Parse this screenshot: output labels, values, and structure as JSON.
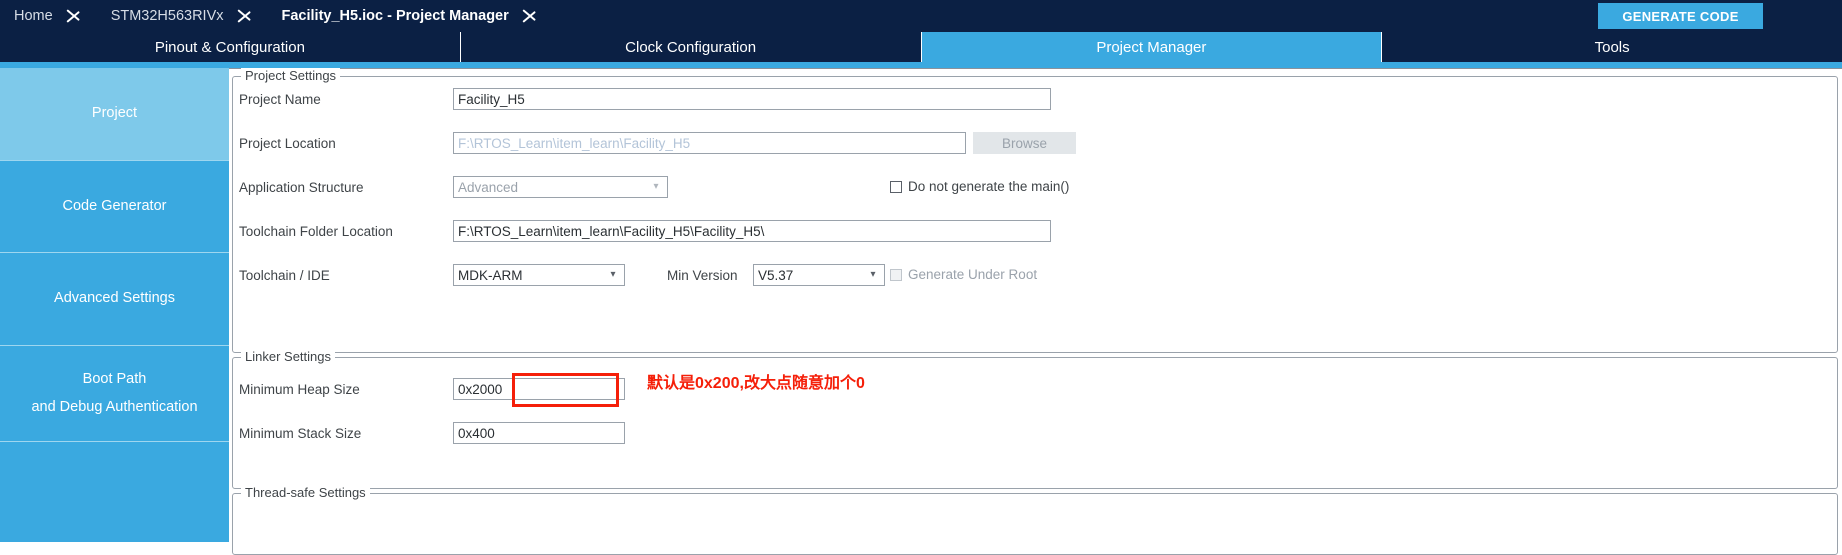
{
  "titlebar": {
    "breadcrumbs": [
      {
        "label": "Home",
        "active": false
      },
      {
        "label": "STM32H563RIVx",
        "active": false
      },
      {
        "label": "Facility_H5.ioc - Project Manager",
        "active": true
      }
    ],
    "generate_code_label": "GENERATE CODE",
    "bg_color": "#0b2044",
    "accent_color": "#3aa9e0"
  },
  "tabs": [
    {
      "label": "Pinout & Configuration",
      "active": false
    },
    {
      "label": "Clock Configuration",
      "active": false
    },
    {
      "label": "Project Manager",
      "active": true
    },
    {
      "label": "Tools",
      "active": false
    }
  ],
  "sidebar": {
    "items": [
      {
        "label": "Project",
        "label2": "",
        "active": true
      },
      {
        "label": "Code Generator",
        "label2": "",
        "active": false
      },
      {
        "label": "Advanced Settings",
        "label2": "",
        "active": false
      },
      {
        "label": "Boot Path",
        "label2": "and Debug Authentication",
        "active": false
      },
      {
        "label": "",
        "label2": "",
        "active": false
      }
    ]
  },
  "project_settings": {
    "group_title": "Project Settings",
    "project_name": {
      "label": "Project Name",
      "value": "Facility_H5"
    },
    "project_location": {
      "label": "Project Location",
      "value": "F:\\RTOS_Learn\\item_learn\\Facility_H5",
      "browse_label": "Browse"
    },
    "application_structure": {
      "label": "Application Structure",
      "value": "Advanced",
      "checkbox_label": "Do not generate the main()",
      "checkbox_checked": false
    },
    "toolchain_folder_location": {
      "label": "Toolchain Folder Location",
      "value": "F:\\RTOS_Learn\\item_learn\\Facility_H5\\Facility_H5\\"
    },
    "toolchain_ide": {
      "label": "Toolchain / IDE",
      "value": "MDK-ARM",
      "min_version_label": "Min Version",
      "min_version_value": "V5.37",
      "generate_under_root_label": "Generate Under Root",
      "generate_under_root_checked": false
    }
  },
  "linker_settings": {
    "group_title": "Linker Settings",
    "minimum_heap_size": {
      "label": "Minimum Heap Size",
      "value": "0x2000"
    },
    "minimum_stack_size": {
      "label": "Minimum Stack Size",
      "value": "0x400"
    }
  },
  "thread_safe_settings": {
    "group_title": "Thread-safe Settings"
  },
  "annotation": {
    "text": "默认是0x200,改大点随意加个0",
    "color": "#f51f09"
  }
}
